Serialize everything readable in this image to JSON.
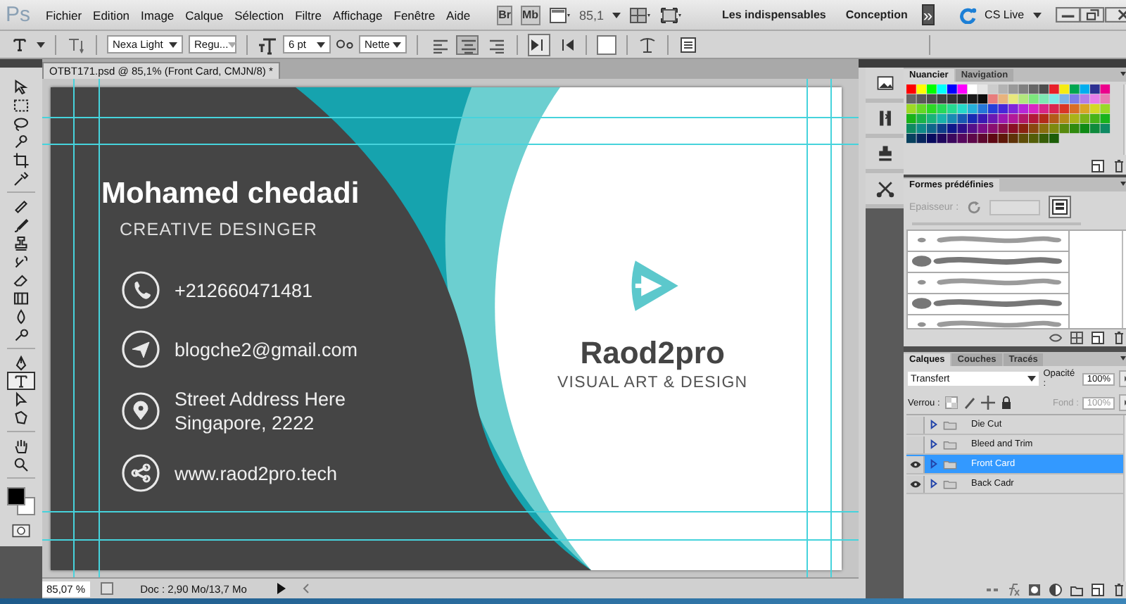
{
  "app_logo": "Ps",
  "menu": [
    "Fichier",
    "Edition",
    "Image",
    "Calque",
    "Sélection",
    "Filtre",
    "Affichage",
    "Fenêtre",
    "Aide"
  ],
  "app_bar": {
    "bridge": "Br",
    "mini_bridge": "Mb",
    "zoom": "85,1"
  },
  "workspaces": [
    "Les indispensables",
    "Conception"
  ],
  "more_workspaces": "»",
  "cs_live": "CS Live",
  "options_bar": {
    "font_family": "Nexa Light",
    "font_style": "Regu...",
    "font_size": "6 pt",
    "antialias": "Nette",
    "alignment": [
      {
        "kind": "left",
        "selected": false
      },
      {
        "kind": "center",
        "selected": true
      },
      {
        "kind": "right",
        "selected": false
      }
    ]
  },
  "document_tab": "OTBT171.psd @ 85,1% (Front Card, CMJN/8) *",
  "tool_groups": [
    [
      {
        "kind": "move",
        "selected": false
      },
      {
        "kind": "marquee",
        "selected": false
      },
      {
        "kind": "lasso",
        "selected": false
      },
      {
        "kind": "quick-select",
        "selected": false
      },
      {
        "kind": "crop",
        "selected": false
      },
      {
        "kind": "eyedropper",
        "selected": false
      }
    ],
    [
      {
        "kind": "healing",
        "selected": false
      },
      {
        "kind": "brush",
        "selected": false
      },
      {
        "kind": "stamp",
        "selected": false
      },
      {
        "kind": "history-brush",
        "selected": false
      },
      {
        "kind": "eraser",
        "selected": false
      },
      {
        "kind": "gradient",
        "selected": false
      },
      {
        "kind": "blur",
        "selected": false
      },
      {
        "kind": "dodge",
        "selected": false
      }
    ],
    [
      {
        "kind": "pen",
        "selected": false
      },
      {
        "kind": "type",
        "selected": true
      },
      {
        "kind": "path-select",
        "selected": false
      },
      {
        "kind": "shape",
        "selected": false
      }
    ],
    [
      {
        "kind": "hand",
        "selected": false
      },
      {
        "kind": "zoom",
        "selected": false
      }
    ]
  ],
  "card": {
    "name": "Mohamed chedadi",
    "title": "CREATIVE DESINGER",
    "contacts": [
      {
        "kind": "phone",
        "lines": [
          "+212660471481"
        ]
      },
      {
        "kind": "email",
        "lines": [
          "blogche2@gmail.com"
        ]
      },
      {
        "kind": "address",
        "lines": [
          "Street Address Here",
          "Singapore, 2222"
        ]
      },
      {
        "kind": "web",
        "lines": [
          "www.raod2pro.tech"
        ]
      }
    ],
    "brand": "Raod2pro",
    "tagline": "VISUAL ART & DESIGN"
  },
  "status_bar": {
    "zoom": "85,07 %",
    "doc_info": "Doc : 2,90 Mo/13,7 Mo"
  },
  "swatches_panel": {
    "tabs": [
      {
        "label": "Nuancier",
        "selected": true
      },
      {
        "label": "Navigation",
        "selected": false
      }
    ]
  },
  "presets_panel": {
    "tabs": [
      {
        "label": "Formes prédéfinies",
        "selected": true
      }
    ],
    "size_label": "Epaisseur :",
    "size_disabled": true,
    "brushes": [
      {
        "kind": "soft"
      },
      {
        "kind": "hard"
      },
      {
        "kind": "soft"
      },
      {
        "kind": "hard"
      },
      {
        "kind": "soft"
      }
    ]
  },
  "layers_panel": {
    "tabs": [
      {
        "label": "Calques",
        "selected": true
      },
      {
        "label": "Couches",
        "selected": false
      },
      {
        "label": "Tracés",
        "selected": false
      }
    ],
    "blend_mode": "Transfert",
    "opacity_label": "Opacité :",
    "opacity": "100%",
    "lock_label": "Verrou :",
    "fill_label": "Fond :",
    "fill": "100%",
    "fill_disabled": true,
    "layers": [
      {
        "name": "Die Cut",
        "visible": false,
        "selected": false
      },
      {
        "name": "Bleed and Trim",
        "visible": false,
        "selected": false
      },
      {
        "name": "Front Card",
        "visible": true,
        "selected": true
      },
      {
        "name": "Back Cadr",
        "visible": true,
        "selected": false
      }
    ]
  }
}
